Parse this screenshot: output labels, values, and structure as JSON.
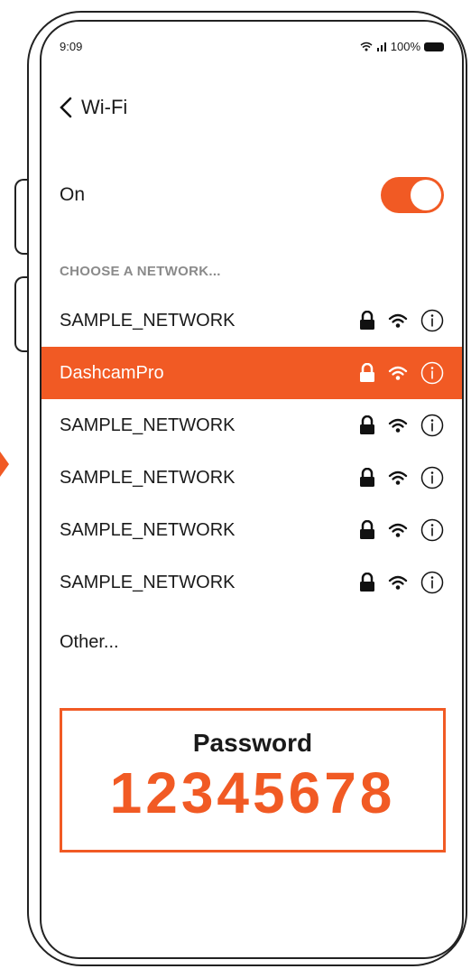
{
  "status": {
    "time": "9:09",
    "battery": "100%"
  },
  "nav": {
    "back_icon": "chevron-left-icon",
    "title": "Wi-Fi"
  },
  "wifi_toggle": {
    "label": "On",
    "state": "on"
  },
  "section_label": "CHOOSE A NETWORK...",
  "networks": [
    {
      "name": "SAMPLE_NETWORK",
      "selected": false
    },
    {
      "name": "DashcamPro",
      "selected": true
    },
    {
      "name": "SAMPLE_NETWORK",
      "selected": false
    },
    {
      "name": "SAMPLE_NETWORK",
      "selected": false
    },
    {
      "name": "SAMPLE_NETWORK",
      "selected": false
    },
    {
      "name": "SAMPLE_NETWORK",
      "selected": false
    }
  ],
  "other_label": "Other...",
  "password": {
    "label": "Password",
    "value": "12345678"
  },
  "colors": {
    "accent": "#f15a24",
    "text": "#1a1a1a",
    "section_label": "#8a8a8a"
  }
}
